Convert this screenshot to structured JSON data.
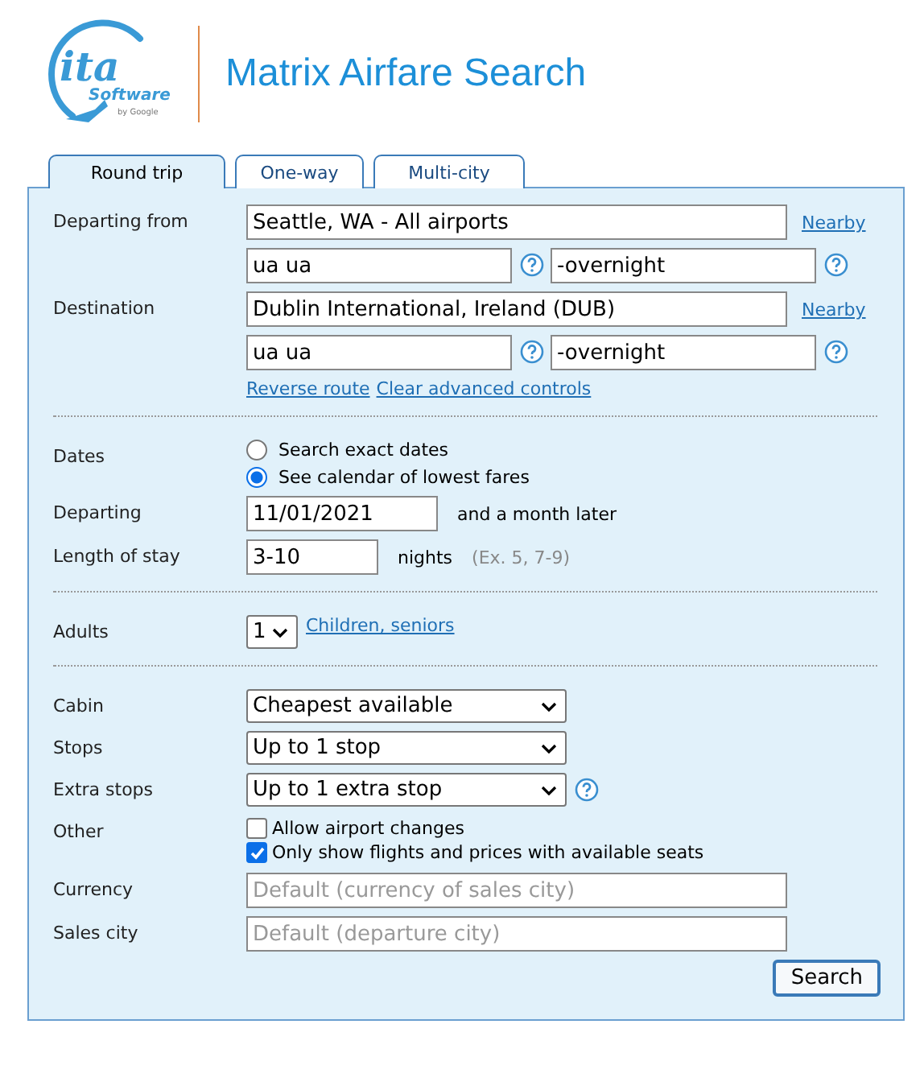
{
  "header": {
    "logo": {
      "mark": "ita",
      "name": "Software",
      "byline": "by Google"
    },
    "title": "Matrix Airfare Search"
  },
  "tabs": [
    {
      "label": "Round trip",
      "selected": true
    },
    {
      "label": "One-way",
      "selected": false
    },
    {
      "label": "Multi-city",
      "selected": false
    }
  ],
  "route": {
    "airports": [
      {
        "label": "Departing from",
        "value": "Seattle, WA - All airports",
        "nearby": "Nearby",
        "routing": "ua ua",
        "extension": "-overnight"
      },
      {
        "label": "Destination",
        "value": "Dublin International, Ireland (DUB)",
        "nearby": "Nearby",
        "routing": "ua ua",
        "extension": "-overnight"
      }
    ],
    "links": [
      "Reverse route",
      "Clear advanced controls"
    ]
  },
  "dates": {
    "label": "Dates",
    "options": [
      {
        "label": "Search exact dates",
        "selected": false
      },
      {
        "label": "See calendar of lowest fares",
        "selected": true
      }
    ],
    "departing": {
      "label": "Departing",
      "value": "11/01/2021",
      "note": "and a month later"
    },
    "stay": {
      "label": "Length of stay",
      "value": "3-10",
      "unit": "nights",
      "example": "(Ex. 5, 7-9)"
    }
  },
  "passengers": {
    "label": "Adults",
    "value": "1",
    "link": "Children, seniors"
  },
  "selects": [
    {
      "label": "Cabin",
      "value": "Cheapest available",
      "help": false
    },
    {
      "label": "Stops",
      "value": "Up to 1 stop",
      "help": false
    },
    {
      "label": "Extra stops",
      "value": "Up to 1 extra stop",
      "help": true
    }
  ],
  "other": {
    "label": "Other",
    "checks": [
      {
        "label": "Allow airport changes",
        "checked": false
      },
      {
        "label": "Only show flights and prices with available seats",
        "checked": true
      }
    ]
  },
  "fields": [
    {
      "label": "Currency",
      "placeholder": "Default (currency of sales city)"
    },
    {
      "label": "Sales city",
      "placeholder": "Default (departure city)"
    }
  ],
  "search_button": "Search"
}
